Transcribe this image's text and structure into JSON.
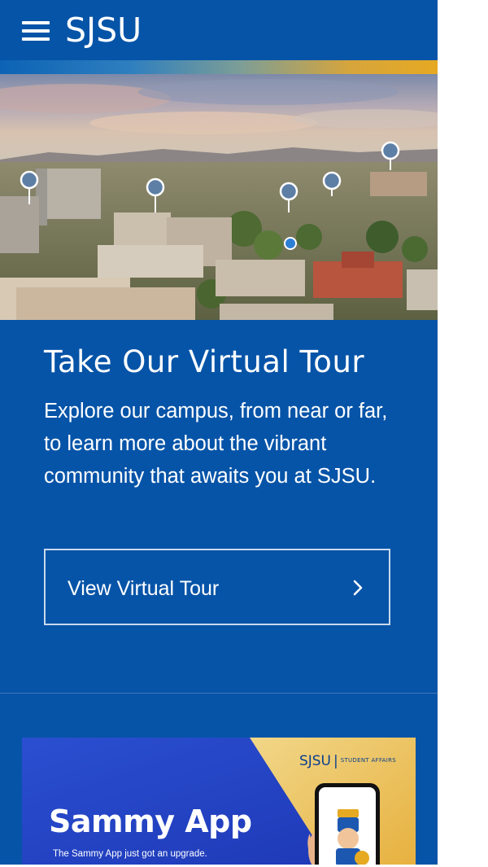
{
  "header": {
    "logo": "SJSU",
    "menu_icon": "hamburger-menu-icon"
  },
  "hero": {
    "image": "aerial-campus-photo"
  },
  "tour": {
    "title": "Take Our Virtual Tour",
    "description": "Explore our campus, from near or far, to learn more about the vibrant community that awaits you at SJSU.",
    "button_label": "View Virtual Tour",
    "button_icon": "chevron-right-icon"
  },
  "promo": {
    "brand": "SJSU",
    "brand_sub": "STUDENT AFFAIRS",
    "title": "Sammy App",
    "subtitle": "The Sammy App just got an upgrade."
  },
  "colors": {
    "primary_blue": "#0654a8",
    "gold": "#e6a922",
    "white": "#ffffff"
  }
}
